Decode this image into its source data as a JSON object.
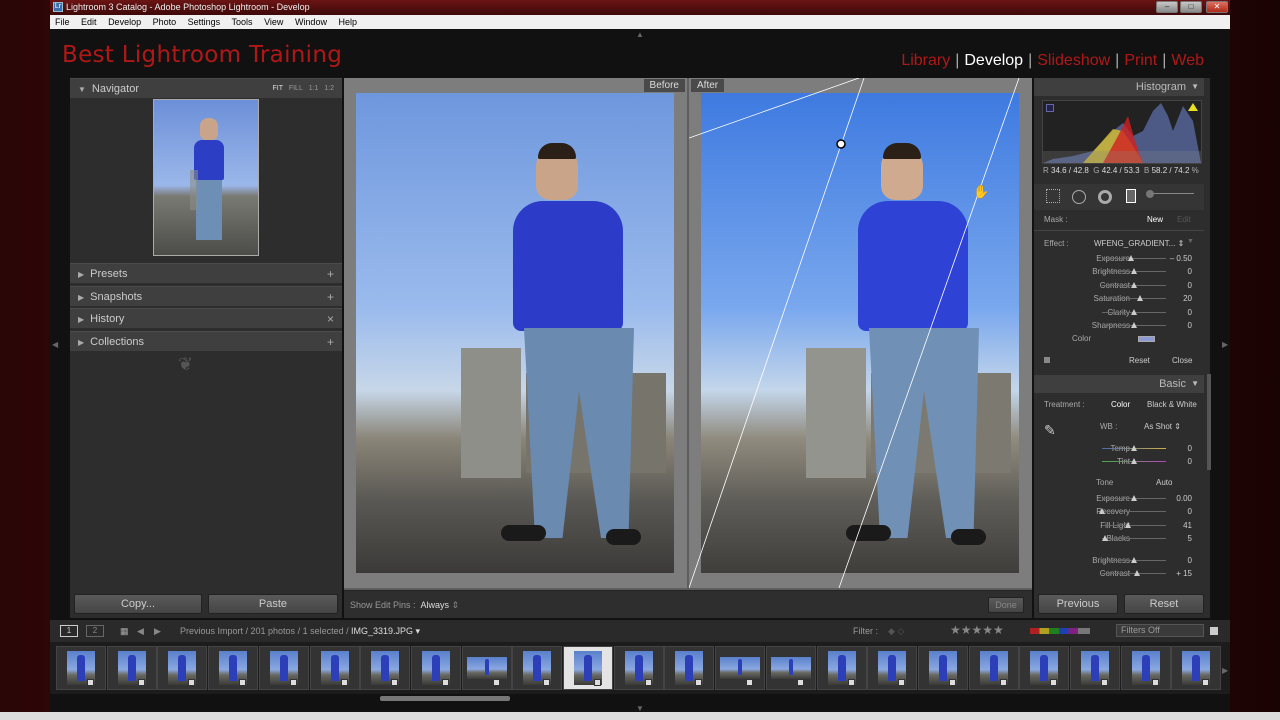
{
  "window": {
    "title": "Lightroom 3 Catalog - Adobe Photoshop Lightroom - Develop",
    "controls": [
      "–",
      "□",
      "✕"
    ]
  },
  "menu": [
    "File",
    "Edit",
    "Develop",
    "Photo",
    "Settings",
    "Tools",
    "View",
    "Window",
    "Help"
  ],
  "identity_plate": "Best Lightroom Training",
  "modules": [
    {
      "label": "Library",
      "active": false
    },
    {
      "label": "Develop",
      "active": true
    },
    {
      "label": "Slideshow",
      "active": false
    },
    {
      "label": "Print",
      "active": false
    },
    {
      "label": "Web",
      "active": false
    }
  ],
  "colors": {
    "accent_red": "#b01818",
    "selection_blue": "#2c3fb8"
  },
  "left_panel": {
    "navigator": {
      "title": "Navigator",
      "zoom": [
        "FIT",
        "FILL",
        "1:1",
        "1:2"
      ]
    },
    "sections": [
      {
        "label": "Presets",
        "action": "+"
      },
      {
        "label": "Snapshots",
        "action": "+"
      },
      {
        "label": "History",
        "action": "×"
      },
      {
        "label": "Collections",
        "action": "+"
      }
    ],
    "copy": "Copy...",
    "paste": "Paste"
  },
  "compare": {
    "before": "Before",
    "after": "After"
  },
  "toolbar": {
    "show_edit_pins_label": "Show Edit Pins :",
    "show_edit_pins_value": "Always",
    "done": "Done"
  },
  "right_panel": {
    "histogram": {
      "title": "Histogram",
      "readout": {
        "r_label": "R",
        "r": "34.6 / 42.8",
        "g_label": "G",
        "g": "42.4 / 53.3",
        "b_label": "B",
        "b": "58.2 / 74.2",
        "pct": "%"
      }
    },
    "mask": {
      "label": "Mask :",
      "new": "New",
      "edit": "Edit"
    },
    "effect": {
      "label": "Effect :",
      "preset": "WFENG_GRADIENT..."
    },
    "gradient_sliders": [
      {
        "label": "Exposure",
        "value": "– 0.50",
        "pos": 0.45
      },
      {
        "label": "Brightness",
        "value": "0",
        "pos": 0.5
      },
      {
        "label": "Contrast",
        "value": "0",
        "pos": 0.5
      },
      {
        "label": "Saturation",
        "value": "20",
        "pos": 0.6
      },
      {
        "label": "Clarity",
        "value": "0",
        "pos": 0.5
      },
      {
        "label": "Sharpness",
        "value": "0",
        "pos": 0.5
      }
    ],
    "color_label": "Color",
    "reset": "Reset",
    "close": "Close",
    "basic": {
      "title": "Basic",
      "treatment_label": "Treatment :",
      "treatment_color": "Color",
      "treatment_bw": "Black & White",
      "wb_label": "WB :",
      "wb_value": "As Shot",
      "temp": {
        "label": "Temp",
        "value": "0",
        "pos": 0.5
      },
      "tint": {
        "label": "Tint",
        "value": "0",
        "pos": 0.5
      },
      "tone_label": "Tone",
      "auto": "Auto",
      "tone_sliders": [
        {
          "label": "Exposure",
          "value": "0.00",
          "pos": 0.5
        },
        {
          "label": "Recovery",
          "value": "0",
          "pos": 0.0
        },
        {
          "label": "Fill Light",
          "value": "41",
          "pos": 0.41
        },
        {
          "label": "Blacks",
          "value": "5",
          "pos": 0.05
        }
      ],
      "presence_sliders": [
        {
          "label": "Brightness",
          "value": "0",
          "pos": 0.5
        },
        {
          "label": "Contrast",
          "value": "+ 15",
          "pos": 0.55
        }
      ]
    },
    "previous": "Previous",
    "reset_all": "Reset"
  },
  "filmstrip_bar": {
    "views": [
      "1",
      "2"
    ],
    "source": "Previous Import / 201 photos / 1 selected /",
    "current": "IMG_3319.JPG",
    "filter_label": "Filter :",
    "filters_off": "Filters Off"
  },
  "filmstrip": {
    "count": 23,
    "selected_index": 10,
    "landscape_indices": [
      8,
      13,
      14
    ]
  }
}
